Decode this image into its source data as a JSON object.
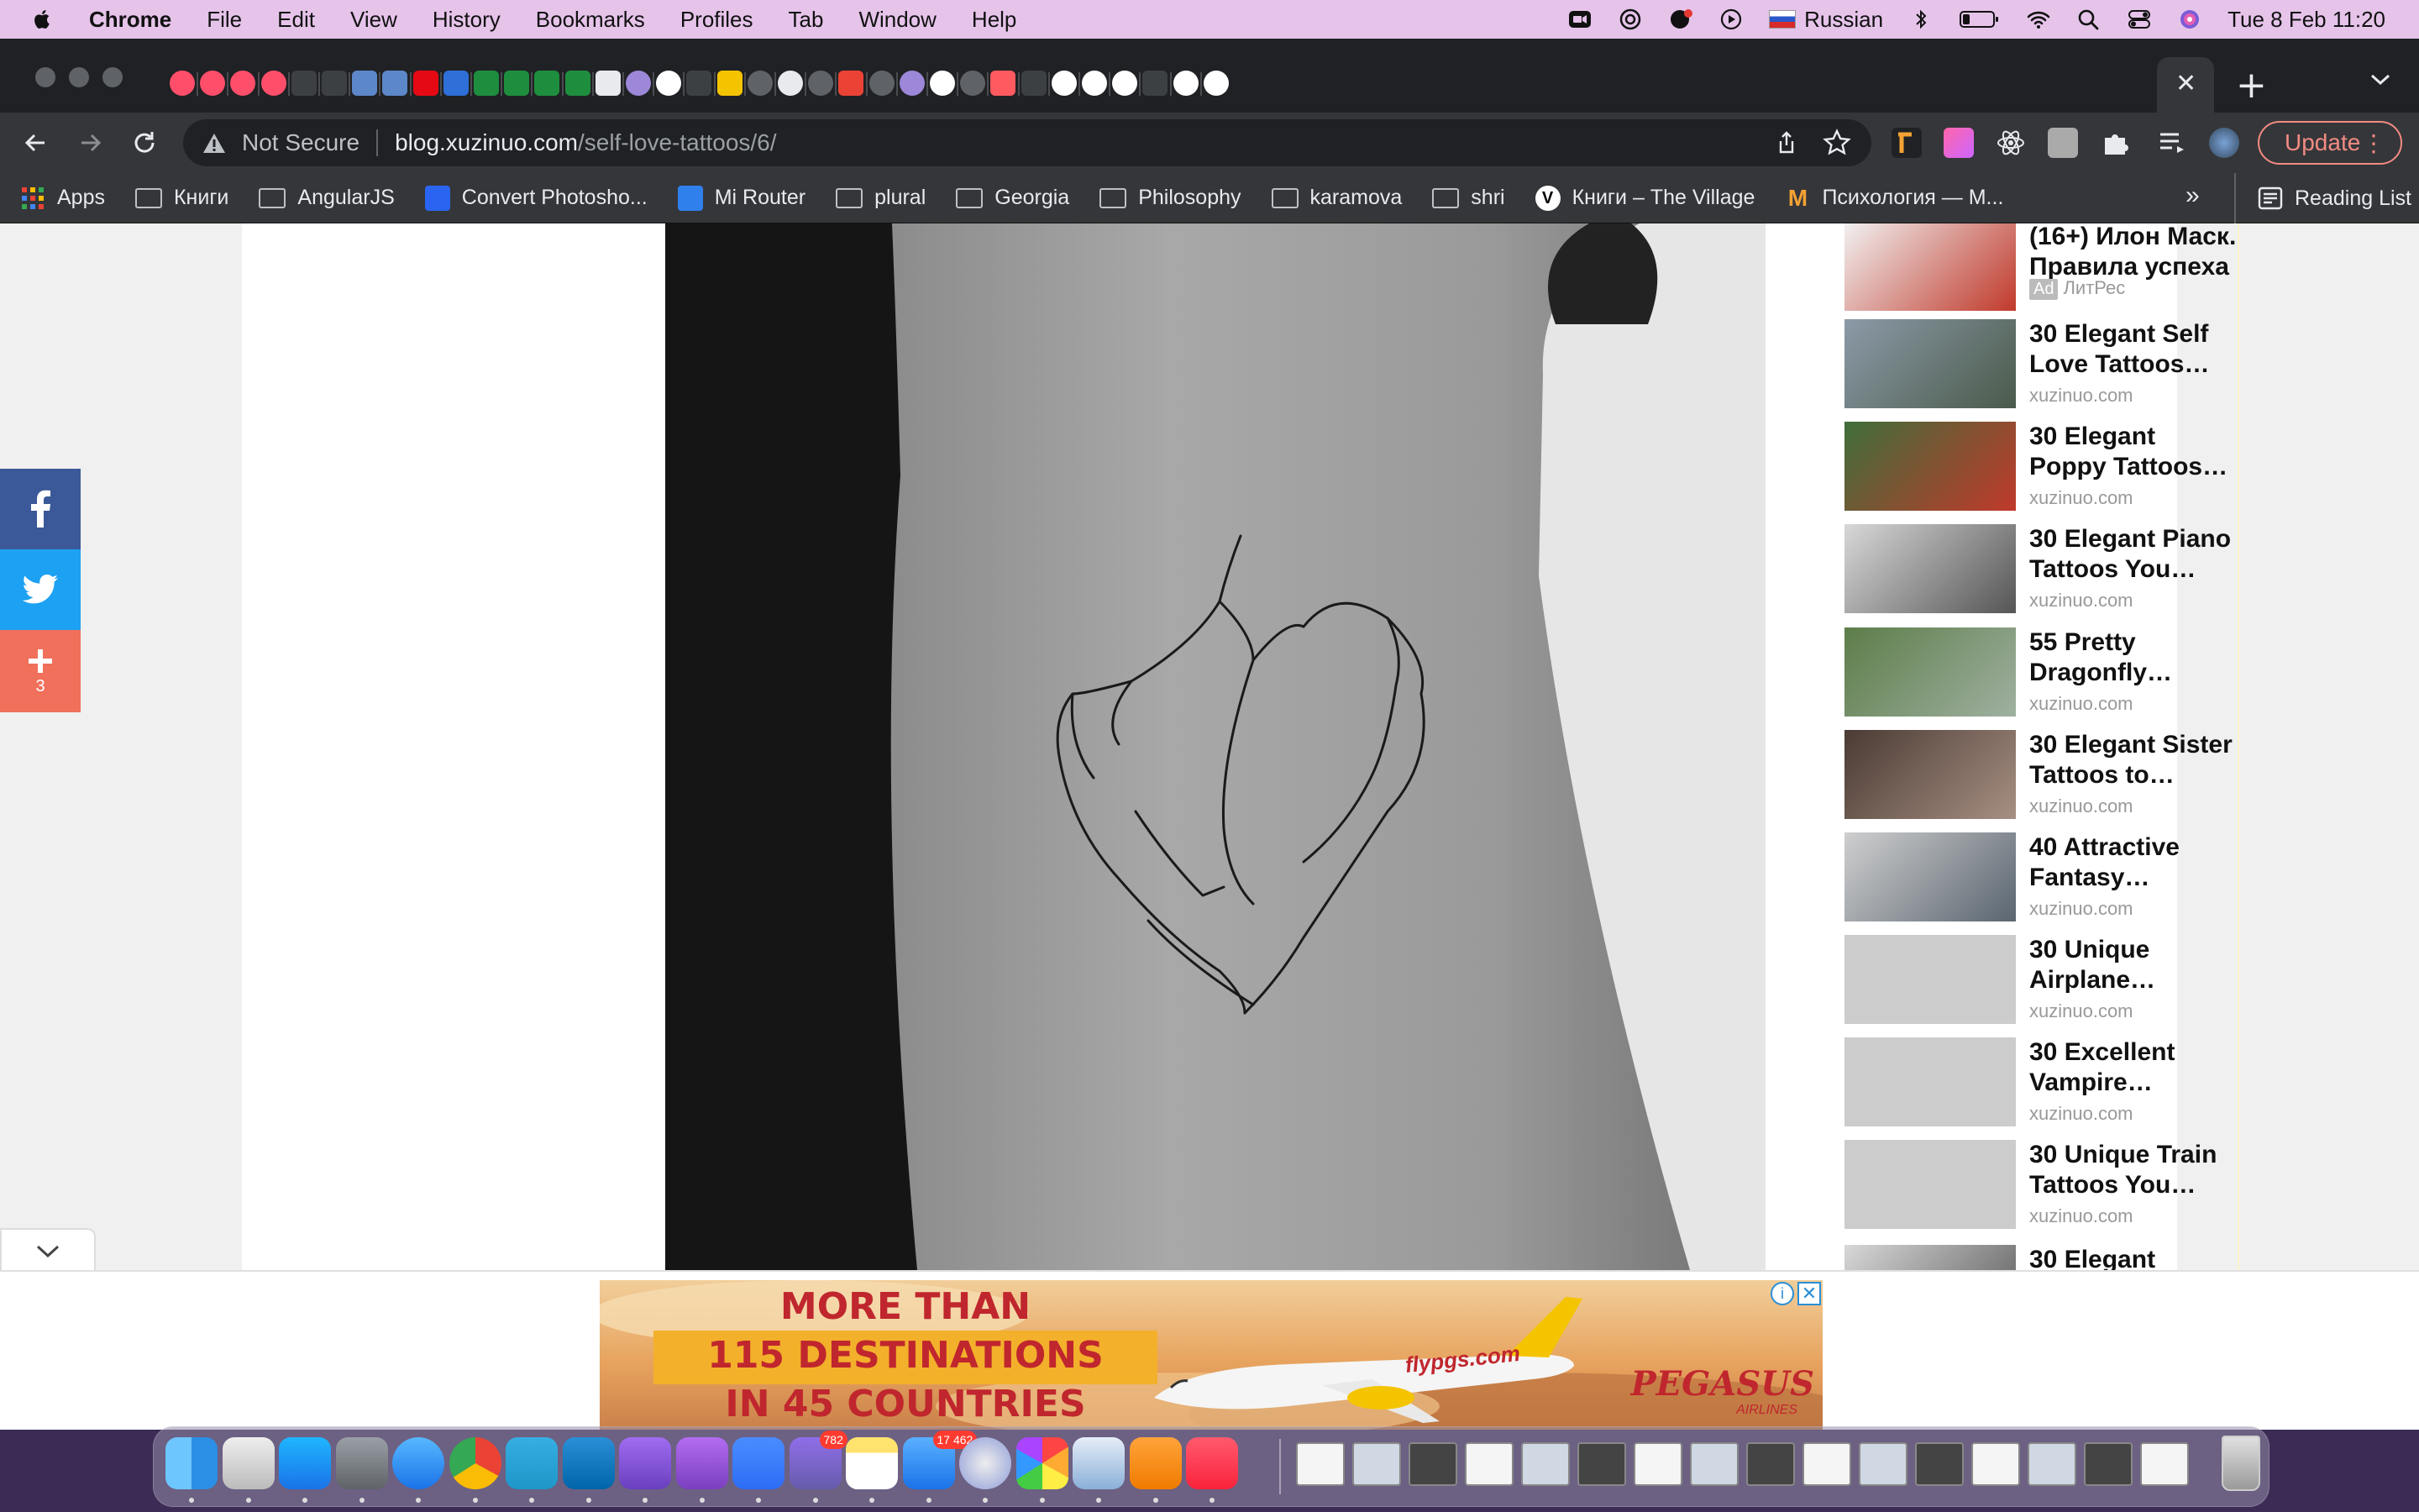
{
  "menubar": {
    "app_name": "Chrome",
    "items": [
      "File",
      "Edit",
      "View",
      "History",
      "Bookmarks",
      "Profiles",
      "Tab",
      "Window",
      "Help"
    ],
    "input_source": "Russian",
    "datetime": "Tue 8 Feb  11:20"
  },
  "tabs": {
    "favicons": [
      "youtube",
      "youtube",
      "youtube",
      "youtube",
      "hd",
      "hd",
      "film",
      "film",
      "netflix",
      "book",
      "puzzle",
      "puzzle",
      "puzzle",
      "plus-green",
      "mask",
      "globe-purple",
      "v-icon",
      "k-icon",
      "ukraine-trident",
      "globe",
      "lock",
      "globe",
      "gmail",
      "globe",
      "globe-purple",
      "google",
      "globe",
      "airbnb",
      "speaker",
      "google",
      "google",
      "google",
      "k-icon",
      "google",
      "google"
    ],
    "active_close": "✕",
    "new_tab": "+"
  },
  "toolbar": {
    "security_label": "Not Secure",
    "url_host": "blog.xuzinuo.com",
    "url_path": "/self-love-tattoos/6/",
    "update_label": "Update"
  },
  "bookmarks": {
    "items": [
      {
        "label": "Apps",
        "icon": "apps-grid-icon"
      },
      {
        "label": "Книги",
        "icon": "folder-icon"
      },
      {
        "label": "AngularJS",
        "icon": "folder-icon"
      },
      {
        "label": "Convert Photosho...",
        "icon": "css3-icon"
      },
      {
        "label": "Mi Router",
        "icon": "wifi-icon"
      },
      {
        "label": "plural",
        "icon": "folder-icon"
      },
      {
        "label": "Georgia",
        "icon": "folder-icon"
      },
      {
        "label": "Philosophy",
        "icon": "folder-icon"
      },
      {
        "label": "karamova",
        "icon": "folder-icon"
      },
      {
        "label": "shri",
        "icon": "folder-icon"
      },
      {
        "label": "Книги – The Village",
        "icon": "v-circle-icon"
      },
      {
        "label": "Психология — M...",
        "icon": "m-icon"
      }
    ],
    "overflow": "»",
    "reading_list": "Reading List"
  },
  "social": {
    "share_count": "3"
  },
  "sidebar": {
    "items": [
      {
        "title": "(16+) Илон Маск. Правила успеха",
        "source": "ЛитРес",
        "ad": "Ad",
        "thumb": "book-cover"
      },
      {
        "title": "30 Elegant Self Love Tattoos…",
        "source": "xuzinuo.com",
        "thumb": "photo"
      },
      {
        "title": "30 Elegant Poppy Tattoos…",
        "source": "xuzinuo.com",
        "thumb": "photo"
      },
      {
        "title": "30 Elegant Piano Tattoos You…",
        "source": "xuzinuo.com",
        "thumb": "photo"
      },
      {
        "title": "55 Pretty Dragonfly…",
        "source": "xuzinuo.com",
        "thumb": "photo"
      },
      {
        "title": "30 Elegant Sister Tattoos to…",
        "source": "xuzinuo.com",
        "thumb": "photo"
      },
      {
        "title": "40 Attractive Fantasy…",
        "source": "xuzinuo.com",
        "thumb": "photo"
      },
      {
        "title": "30 Unique Airplane…",
        "source": "xuzinuo.com",
        "thumb": "placeholder"
      },
      {
        "title": "30 Excellent Vampire…",
        "source": "xuzinuo.com",
        "thumb": "placeholder"
      },
      {
        "title": "30 Unique Train Tattoos You…",
        "source": "xuzinuo.com",
        "thumb": "placeholder"
      },
      {
        "title": "30 Elegant",
        "source": "",
        "thumb": "photo"
      }
    ]
  },
  "ad": {
    "line1": "MORE THAN",
    "line2": "115 DESTINATIONS",
    "line3": "IN 45 COUNTRIES",
    "brand": "PEGASUS",
    "brand_sub": "AIRLINES",
    "plane_text": "flypgs.com",
    "info": "ⓘ",
    "close": "✕"
  },
  "dock": {
    "apps": [
      "finder",
      "launchpad",
      "app-store",
      "system-preferences",
      "safari",
      "chrome",
      "telegram",
      "vscode",
      "imovie",
      "podcasts",
      "zoom",
      "viber",
      "notes",
      "mail",
      "arc",
      "photos",
      "preview",
      "books",
      "music"
    ],
    "badges": {
      "viber": "782",
      "mail": "17 462"
    }
  }
}
